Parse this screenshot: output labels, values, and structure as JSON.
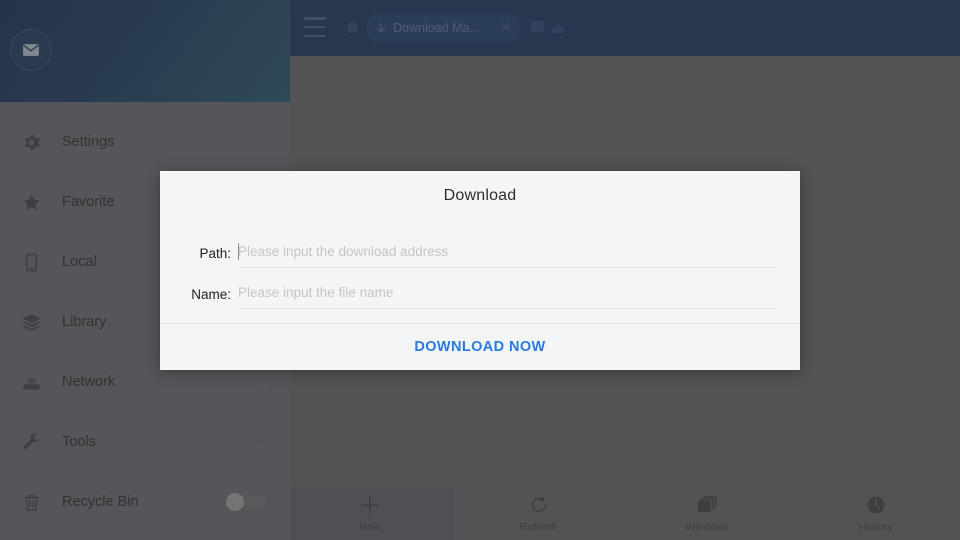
{
  "browser": {
    "menu_icon": "hamburger-icon",
    "home_icon": "home-icon",
    "tab": {
      "icon": "download-arrow-icon",
      "title": "Download Ma...",
      "close_icon": "close-icon"
    },
    "right_icons": [
      {
        "name": "windows-square-icon"
      },
      {
        "name": "cloud-icon"
      }
    ],
    "header_color": "#132d59"
  },
  "sidebar": {
    "avatar_icon": "envelope-icon",
    "header_gradient_from": "#0f2750",
    "header_gradient_to": "#1e5068",
    "items": [
      {
        "label": "Settings",
        "icon": "gear-icon",
        "accessory": "none"
      },
      {
        "label": "Favorite",
        "icon": "star-icon",
        "accessory": "none"
      },
      {
        "label": "Local",
        "icon": "phone-icon",
        "accessory": "none"
      },
      {
        "label": "Library",
        "icon": "layers-icon",
        "accessory": "none"
      },
      {
        "label": "Network",
        "icon": "router-icon",
        "accessory": "chevron"
      },
      {
        "label": "Tools",
        "icon": "wrench-icon",
        "accessory": "chevron"
      },
      {
        "label": "Recycle Bin",
        "icon": "trash-icon",
        "accessory": "toggle",
        "toggle_on": false
      }
    ]
  },
  "dialog": {
    "title": "Download",
    "fields": [
      {
        "label": "Path:",
        "value": "",
        "placeholder": "Please input the download address",
        "focused": true
      },
      {
        "label": "Name:",
        "value": "",
        "placeholder": "Please input the file name",
        "focused": false
      }
    ],
    "action_label": "DOWNLOAD NOW",
    "action_color": "#2a7ae4",
    "background": "#f4f5f7"
  },
  "bottom_nav": {
    "items": [
      {
        "label": "New",
        "icon": "plus-icon",
        "active": true
      },
      {
        "label": "Refresh",
        "icon": "refresh-icon",
        "active": false
      },
      {
        "label": "Windows",
        "icon": "windows-icon",
        "active": false
      },
      {
        "label": "History",
        "icon": "clock-icon",
        "active": false
      }
    ]
  }
}
